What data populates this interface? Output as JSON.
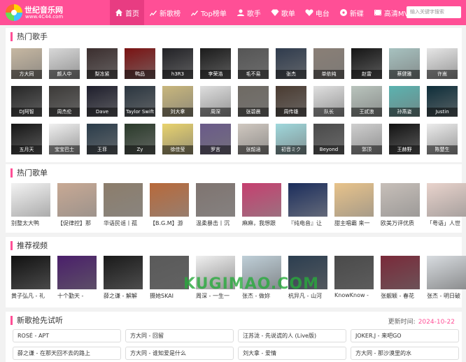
{
  "site": {
    "name": "世纪音乐网",
    "url": "www.4C44.com"
  },
  "nav": [
    {
      "label": "首页",
      "icon": "home-icon"
    },
    {
      "label": "新歌榜",
      "icon": "chart-icon"
    },
    {
      "label": "Top榜单",
      "icon": "chart-icon"
    },
    {
      "label": "歌手",
      "icon": "user-icon"
    },
    {
      "label": "歌单",
      "icon": "diamond-icon"
    },
    {
      "label": "电台",
      "icon": "heart-icon"
    },
    {
      "label": "新碟",
      "icon": "disc-icon"
    },
    {
      "label": "高清MV",
      "icon": "film-icon"
    }
  ],
  "search": {
    "placeholder": "输入关键字搜索"
  },
  "singers": {
    "title": "热门歌手",
    "items": [
      {
        "name": "方大同",
        "color": "#c7b8a2"
      },
      {
        "name": "颜人中",
        "color": "#d8d8d8"
      },
      {
        "name": "梨冻紧",
        "color": "#3b2e2e"
      },
      {
        "name": "鸭品",
        "color": "#7a1212"
      },
      {
        "name": "h3R3",
        "color": "#222226"
      },
      {
        "name": "李荣浩",
        "color": "#1b1b1b"
      },
      {
        "name": "毛不易",
        "color": "#555555"
      },
      {
        "name": "张杰",
        "color": "#2f3b4d"
      },
      {
        "name": "单依纯",
        "color": "#8a7f76"
      },
      {
        "name": "赵雷",
        "color": "#151515"
      },
      {
        "name": "蔡健雅",
        "color": "#a7c2c0"
      },
      {
        "name": "许嵩",
        "color": "#e6e6e6"
      },
      {
        "name": "DJ阿智",
        "color": "#262626"
      },
      {
        "name": "周杰伦",
        "color": "#3c3a38"
      },
      {
        "name": "Dave",
        "color": "#1e1e2c"
      },
      {
        "name": "Taylor Swift",
        "color": "#2b3640"
      },
      {
        "name": "刘大拿",
        "color": "#c9b77c"
      },
      {
        "name": "周深",
        "color": "#dedede"
      },
      {
        "name": "张碧晨",
        "color": "#6f6a63"
      },
      {
        "name": "周传雄",
        "color": "#4a3b31"
      },
      {
        "name": "队长",
        "color": "#e0e0e0"
      },
      {
        "name": "王贰浪",
        "color": "#b9c4bd"
      },
      {
        "name": "孙燕姿",
        "color": "#5bb3b0"
      },
      {
        "name": "Justin",
        "color": "#0e2e3a"
      },
      {
        "name": "五月天",
        "color": "#151515"
      },
      {
        "name": "宝宝巴士",
        "color": "#f0f0f0"
      },
      {
        "name": "王菲",
        "color": "#2a3c4a"
      },
      {
        "name": "Zy",
        "color": "#2a3a2a"
      },
      {
        "name": "徐佳莹",
        "color": "#e9d36d"
      },
      {
        "name": "罗言",
        "color": "#6a5a8a"
      },
      {
        "name": "张韶涵",
        "color": "#d0c8c0"
      },
      {
        "name": "初音ミク",
        "color": "#9fd8dc"
      },
      {
        "name": "Beyond",
        "color": "#4a4a4a"
      },
      {
        "name": "郭顶",
        "color": "#cfcfcf"
      },
      {
        "name": "王赫野",
        "color": "#121212"
      },
      {
        "name": "陈楚生",
        "color": "#ececec"
      }
    ]
  },
  "playlists": {
    "title": "热门歌单",
    "items": [
      {
        "caption": "别整太大鸭",
        "color": "#f3f3f3"
      },
      {
        "caption": "【促律控】那",
        "color": "#c8a994"
      },
      {
        "caption": "华语民谣丨孤",
        "color": "#8c7d6b"
      },
      {
        "caption": "【B.G.M】游",
        "color": "#b8693a"
      },
      {
        "caption": "温柔暴击丨沉",
        "color": "#7f7470"
      },
      {
        "caption": "麻麻，我想跟",
        "color": "#c63f6f"
      },
      {
        "caption": "『纯电音』让",
        "color": "#1b2d5c"
      },
      {
        "caption": "甜主唱霸 来一",
        "color": "#e8c38a"
      },
      {
        "caption": "欧美万评优质",
        "color": "#c7bfb9"
      },
      {
        "caption": "「粤语」人世",
        "color": "#e9d3cc"
      }
    ]
  },
  "videos": {
    "title": "推荐视频",
    "items": [
      {
        "caption": "黄子弘凡 - 礼",
        "color": "#111111"
      },
      {
        "caption": "十个勤天 -",
        "color": "#4a1f6a"
      },
      {
        "caption": "薛之谦 - 解解",
        "color": "#1a1a1a"
      },
      {
        "caption": "摄她SKAI",
        "color": "#5a5a5a"
      },
      {
        "caption": "周深 - 一生一",
        "color": "#f0f0f0"
      },
      {
        "caption": "张杰 - 做妳",
        "color": "#bfcfd8"
      },
      {
        "caption": "杭异凡 - 山河",
        "color": "#2c3e50"
      },
      {
        "caption": "KnowKnow -",
        "color": "#4a4a4a"
      },
      {
        "caption": "张靓颖 - 春花",
        "color": "#7a2a3a"
      },
      {
        "caption": "张杰 - 明日破",
        "color": "#d8dce0"
      }
    ]
  },
  "new_songs": {
    "title": "新歌抢先试听",
    "time_label": "更新时间:",
    "time_value": "2024-10-22",
    "items": [
      "ROSÉ - APT",
      "方大同 - 回留",
      "汪苏泷 - 先说谎的人 (Live版)",
      "JOKER.J - 来吧GO",
      "薛之谦 - 在那天回不去的路上",
      "方大同 - 谁知爱是什么",
      "刘大拿 - 爱情",
      "方大同 - 那沙漠里的水"
    ]
  },
  "watermark": "KUGIMAO.COM",
  "colors": {
    "brand": "#ff4f96",
    "brand_dark": "#e83c82",
    "date": "#ff4f96"
  }
}
